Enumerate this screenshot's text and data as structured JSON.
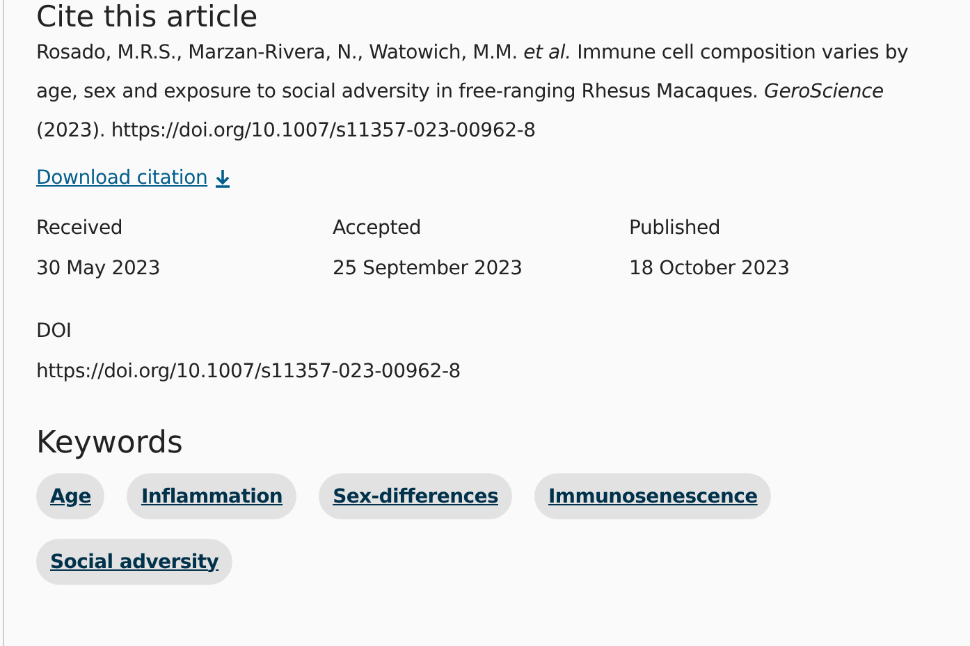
{
  "cite_section": {
    "heading": "Cite this article",
    "citation": "Rosado, M.R.S., Marzan-Rivera, N., Watowich, M.M. *et al.* Immune cell composition varies by age, sex and exposure to social adversity in free-ranging Rhesus Macaques. *GeroScience* (2023). https://doi.org/10.1007/s11357-023-00962-8",
    "download_link": "Download citation",
    "dates": [
      {
        "label": "Received",
        "value": "30 May 2023"
      },
      {
        "label": "Accepted",
        "value": "25 September 2023"
      },
      {
        "label": "Published",
        "value": "18 October 2023"
      }
    ],
    "doi": {
      "label": "DOI",
      "value": "https://doi.org/10.1007/s11357-023-00962-8"
    }
  },
  "keywords_section": {
    "heading": "Keywords",
    "keywords": [
      "Age",
      "Inflammation",
      "Sex-differences",
      "Immunosenescence",
      "Social adversity"
    ]
  }
}
